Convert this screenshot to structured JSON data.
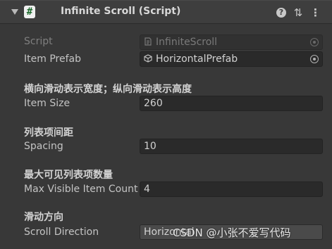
{
  "component": {
    "title": "Infinite Scroll (Script)",
    "enable_glyph": "#",
    "help_glyph": "?",
    "preset_glyph": "⇅",
    "more_glyph": "⋮"
  },
  "fields": {
    "script": {
      "label": "Script",
      "value": "InfiniteScroll"
    },
    "item_prefab": {
      "label": "Item Prefab",
      "value": "HorizontalPrefab"
    },
    "item_size": {
      "header": "横向滑动表示宽度；纵向滑动表示高度",
      "label": "Item Size",
      "value": "260"
    },
    "spacing": {
      "header": "列表项间距",
      "label": "Spacing",
      "value": "10"
    },
    "max_visible": {
      "header": "最大可见列表项数量",
      "label": "Max Visible Item Count",
      "value": "4"
    },
    "scroll_direction": {
      "header": "滑动方向",
      "label": "Scroll Direction",
      "value": "Horizontal"
    }
  },
  "watermark": "CSDN @小张不爱写代码",
  "colors": {
    "background": "#383838",
    "header": "#3e3e3e",
    "field": "#2a2a2a",
    "script_icon": "#1e6b2e"
  }
}
